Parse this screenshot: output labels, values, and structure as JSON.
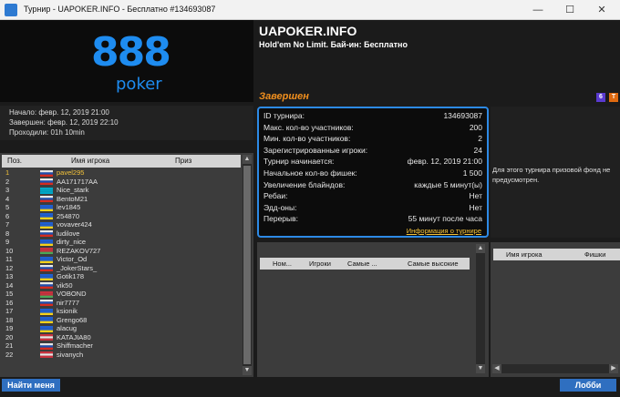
{
  "window": {
    "title": "Турнир - UAPOKER.INFO - Бесплатно #134693087",
    "minimize": "—",
    "maximize": "☐",
    "close": "✕"
  },
  "logo": {
    "number": "888",
    "word": "poker"
  },
  "times": {
    "start": "Начало: февр. 12, 2019 21:00",
    "end": "Завершен: февр. 12, 2019 22:10",
    "elapsed": "Проходили: 01h 10min"
  },
  "players_table": {
    "headers": [
      "Поз.",
      "Имя игрока",
      "Приз"
    ],
    "rows": [
      {
        "pos": "1",
        "name": "pavel295",
        "flag": [
          "#e8e8e8",
          "#1f4fb0",
          "#d52b1e"
        ],
        "highlight": true
      },
      {
        "pos": "2",
        "name": "AA171717AA",
        "flag": [
          "#e8e8e8",
          "#1f4fb0",
          "#d52b1e"
        ],
        "highlight": false
      },
      {
        "pos": "3",
        "name": "Nice_stark",
        "flag": [
          "#00a7c6",
          "#00a7c6",
          "#00a7c6"
        ],
        "highlight": false
      },
      {
        "pos": "4",
        "name": "BentoM21",
        "flag": [
          "#e8e8e8",
          "#1f4fb0",
          "#d52b1e"
        ],
        "highlight": false
      },
      {
        "pos": "5",
        "name": "lev1845",
        "flag": [
          "#1f5fd0",
          "#1f5fd0",
          "#f6d11a"
        ],
        "highlight": false
      },
      {
        "pos": "6",
        "name": "254870",
        "flag": [
          "#1f5fd0",
          "#1f5fd0",
          "#f6d11a"
        ],
        "highlight": false
      },
      {
        "pos": "7",
        "name": "vovaver424",
        "flag": [
          "#1f5fd0",
          "#1f5fd0",
          "#f6d11a"
        ],
        "highlight": false
      },
      {
        "pos": "8",
        "name": "ludilove",
        "flag": [
          "#e8e8e8",
          "#1f4fb0",
          "#d52b1e"
        ],
        "highlight": false
      },
      {
        "pos": "9",
        "name": "dirty_nice",
        "flag": [
          "#1f5fd0",
          "#1f5fd0",
          "#f6d11a"
        ],
        "highlight": false
      },
      {
        "pos": "10",
        "name": "REZAKOV727",
        "flag": [
          "#c8313e",
          "#c8313e",
          "#4aa657"
        ],
        "highlight": false
      },
      {
        "pos": "11",
        "name": "Victor_Od",
        "flag": [
          "#1f5fd0",
          "#1f5fd0",
          "#f6d11a"
        ],
        "highlight": false
      },
      {
        "pos": "12",
        "name": "_JokerStars_",
        "flag": [
          "#e8e8e8",
          "#1f4fb0",
          "#d52b1e"
        ],
        "highlight": false
      },
      {
        "pos": "13",
        "name": "Gotik178",
        "flag": [
          "#1f5fd0",
          "#1f5fd0",
          "#f6d11a"
        ],
        "highlight": false
      },
      {
        "pos": "14",
        "name": "vik50",
        "flag": [
          "#e8e8e8",
          "#1f4fb0",
          "#d52b1e"
        ],
        "highlight": false
      },
      {
        "pos": "15",
        "name": "VOBOND",
        "flag": [
          "#c8313e",
          "#c8313e",
          "#4aa657"
        ],
        "highlight": false
      },
      {
        "pos": "16",
        "name": "nir7777",
        "flag": [
          "#e8e8e8",
          "#1f4fb0",
          "#d52b1e"
        ],
        "highlight": false
      },
      {
        "pos": "17",
        "name": "ksionik",
        "flag": [
          "#1f5fd0",
          "#1f5fd0",
          "#f6d11a"
        ],
        "highlight": false
      },
      {
        "pos": "18",
        "name": "Grengo68",
        "flag": [
          "#1f5fd0",
          "#1f5fd0",
          "#f6d11a"
        ],
        "highlight": false
      },
      {
        "pos": "19",
        "name": "alacug",
        "flag": [
          "#1f5fd0",
          "#1f5fd0",
          "#f6d11a"
        ],
        "highlight": false
      },
      {
        "pos": "20",
        "name": "KATAJIA80",
        "flag": [
          "#c8313e",
          "#e8e8e8",
          "#c8313e"
        ],
        "highlight": false
      },
      {
        "pos": "21",
        "name": "Shiffmacher",
        "flag": [
          "#e8e8e8",
          "#1f4fb0",
          "#d52b1e"
        ],
        "highlight": false
      },
      {
        "pos": "22",
        "name": "sivanych",
        "flag": [
          "#c8313e",
          "#e8e8e8",
          "#c8313e"
        ],
        "highlight": false
      }
    ]
  },
  "buttons": {
    "find_me": "Найти меня",
    "lobby": "Лобби"
  },
  "header": {
    "site": "UAPOKER.INFO",
    "game": "Hold'em No Limit. Бай-ин: Бесплатно",
    "status": "Завершен",
    "badge_six": "6",
    "badge_turbo": "T"
  },
  "info": {
    "rows": [
      {
        "key": "ID турнира:",
        "value": "134693087"
      },
      {
        "key": "Макс. кол-во участников:",
        "value": "200"
      },
      {
        "key": "Мин. кол-во участников:",
        "value": "2"
      },
      {
        "key": "Зарегистрированные игроки:",
        "value": "24"
      },
      {
        "key": "Турнир начинается:",
        "value": "февр. 12, 2019 21:00"
      },
      {
        "key": "Начальное кол-во фишек:",
        "value": "1 500"
      },
      {
        "key": "Увеличение блайндов:",
        "value": "каждые 5 минут(ы)"
      },
      {
        "key": "Ребаи:",
        "value": "Нет"
      },
      {
        "key": "Эдд-оны:",
        "value": "Нет"
      },
      {
        "key": "Перерыв:",
        "value": "55 минут после часа"
      }
    ],
    "link": "Информация о турнире"
  },
  "prize_text": "Для этого турнира призовой фонд не предусмотрен.",
  "tables_table": {
    "headers": [
      "Ном...",
      "Игроки",
      "Самые ...",
      "Самые высокие"
    ]
  },
  "players2_table": {
    "headers": [
      "Имя игрока",
      "Фишки"
    ]
  },
  "scroll": {
    "up": "▲",
    "down": "▼",
    "left": "◀",
    "right": "▶"
  },
  "colors": {
    "accent": "#2d8ae6",
    "status": "#f08f1e",
    "highlight": "#f3c23a",
    "brand": "#1e8cf0"
  }
}
